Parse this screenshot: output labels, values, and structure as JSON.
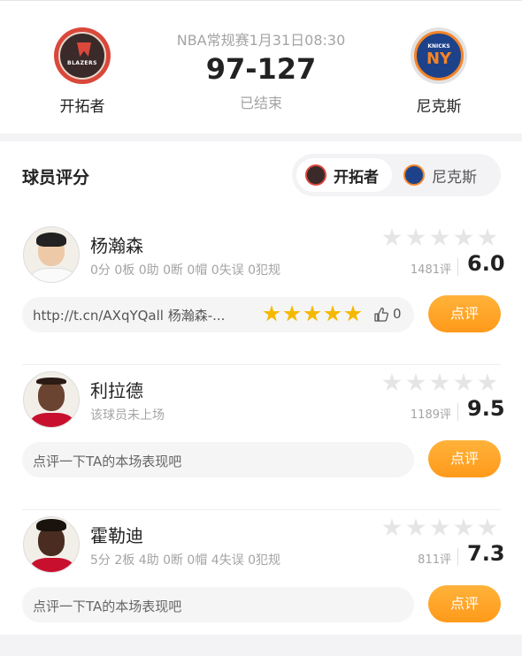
{
  "game": {
    "info": "NBA常规赛1月31日08:30",
    "score": "97-127",
    "status": "已结束",
    "home_team": {
      "name": "开拓者",
      "logo_text": "BLAZERS"
    },
    "away_team": {
      "name": "尼克斯",
      "logo_text1": "KNICKS",
      "logo_text2": "NY"
    }
  },
  "ratings": {
    "title": "球员评分",
    "tabs": [
      {
        "label": "开拓者",
        "active": true
      },
      {
        "label": "尼克斯",
        "active": false
      }
    ]
  },
  "players": [
    {
      "name": "杨瀚森",
      "stats": "0分 0板 0助 0断 0帽 0失误 0犯规",
      "rating_count": "1481评",
      "score": "6.0",
      "comment": "http://t.cn/AXqYQall 杨瀚森-...",
      "comment_stars": 5,
      "likes": "0",
      "button": "点评"
    },
    {
      "name": "利拉德",
      "stats": "该球员未上场",
      "rating_count": "1189评",
      "score": "9.5",
      "prompt": "点评一下TA的本场表现吧",
      "button": "点评"
    },
    {
      "name": "霍勒迪",
      "stats": "5分 2板 4助 0断 0帽 4失误 0犯规",
      "rating_count": "811评",
      "score": "7.3",
      "prompt": "点评一下TA的本场表现吧",
      "button": "点评"
    }
  ],
  "colors": {
    "accent": "#ff9a1a",
    "star_filled": "#f5b800",
    "star_empty": "#e5e5e5"
  }
}
